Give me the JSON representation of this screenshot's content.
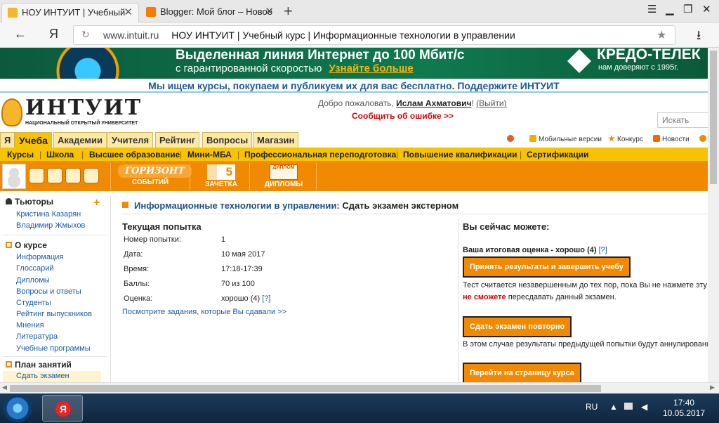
{
  "browser": {
    "tabs": [
      {
        "title": "НОУ ИНТУИТ | Учебный"
      },
      {
        "title": "Blogger: Мой блог – Новое"
      }
    ],
    "new_tab_glyph": "+",
    "back_glyph": "←",
    "yandex_glyph": "Я",
    "reload_glyph": "↻",
    "host": "www.intuit.ru",
    "page_title": "НОУ ИНТУИТ | Учебный курс | Информационные технологии в управлении",
    "star_glyph": "★",
    "download_glyph": "⭳",
    "menu_glyph": "☰",
    "minimize_glyph": "▁",
    "restore_glyph": "❐",
    "close_glyph": "✕"
  },
  "banner": {
    "line1": "Выделенная линия Интернет до 100 Мбит/с",
    "line2": "с гарантированной скоростью",
    "cta": "Узнайте больше",
    "brand": "КРЕДО-ТЕЛЕК",
    "brand_sub": "нам доверяют с 1995г."
  },
  "promo": "Мы ищем курсы, покупаем и публикуем их для вас бесплатно. Поддержите ИНТУИТ",
  "header": {
    "logo_name": "ИНТУИТ",
    "logo_tag": "НАЦИОНАЛЬНЫЙ ОТКРЫТЫЙ УНИВЕРСИТЕТ",
    "welcome": "Добро пожаловать,",
    "user": "Ислам Ахматович",
    "exit": "(Выйти)",
    "report": "Сообщить об ошибке >>",
    "search_placeholder": "Искать"
  },
  "main_tabs": [
    "Я",
    "Учеба",
    "Академии",
    "Учителя",
    "Рейтинг",
    "Вопросы",
    "Магазин"
  ],
  "top_links": {
    "mobile": "Мобильные версии",
    "contest": "Конкурс",
    "news": "Новости"
  },
  "sub_nav": [
    "Курсы",
    "Школа",
    "Высшее образование",
    "Мини-МБА",
    "Профессиональная переподготовка",
    "Повышение квалификации",
    "Сертификации"
  ],
  "user_bar": {
    "horizon_1": "ГОРИЗОНТ",
    "horizon_2": "СОБЫТИЙ",
    "gradebook_num": "5",
    "gradebook": "ЗАЧЕТКА",
    "diploma_tag": "ДИПЛОМ",
    "diplomas": "ДИПЛОМЫ"
  },
  "sidebar": {
    "tutors_title": "Тьюторы",
    "plus": "+",
    "tutors": [
      "Кристина Казарян",
      "Владимир Жмыхов"
    ],
    "about_title": "О курсе",
    "about": [
      "Информация",
      "Глоссарий",
      "Дипломы",
      "Вопросы и ответы",
      "Студенты",
      "Рейтинг выпускников",
      "Мнения",
      "Литература",
      "Учебные программы"
    ],
    "plan_title": "План занятий",
    "plan": [
      "Сдать экзамен"
    ]
  },
  "content": {
    "course": "Информационные технологии в управлении",
    "action": "Сдать экзамен экстерном",
    "attempt_title": "Текущая попытка",
    "rows": [
      {
        "k": "Номер попытки:",
        "v": "1"
      },
      {
        "k": "Дата:",
        "v": "10 мая 2017"
      },
      {
        "k": "Время:",
        "v": "17:18-17:39"
      },
      {
        "k": "Баллы:",
        "v": "70 из 100"
      },
      {
        "k": "Оценка:",
        "v": "хорошо (4)"
      }
    ],
    "help": "[?]",
    "view_link": "Посмотрите задания, которые Вы сдавали >>",
    "can_title": "Вы сейчас можете:",
    "grade_text": "Ваша итоговая оценка - хорошо (4)",
    "btn_accept": "Принять результаты и завершить учебу",
    "note1": "Тест считается незавершенным до тех пор, пока Вы не нажмете эту к",
    "note2_bold": "не сможете",
    "note2_rest": "пересдавать данный экзамен.",
    "btn_retake": "Сдать экзамен повторно",
    "note3": "В этом случае результаты предыдущей попытки будут аннулированы.",
    "btn_course": "Перейти на страницу курса"
  },
  "taskbar": {
    "lang": "RU",
    "time": "17:40",
    "date": "10.05.2017"
  },
  "colors": {
    "accent_orange": "#f18a00",
    "tab_yellow": "#f8c300",
    "link_blue": "#1a5ab0",
    "error_red": "#dd0000"
  }
}
